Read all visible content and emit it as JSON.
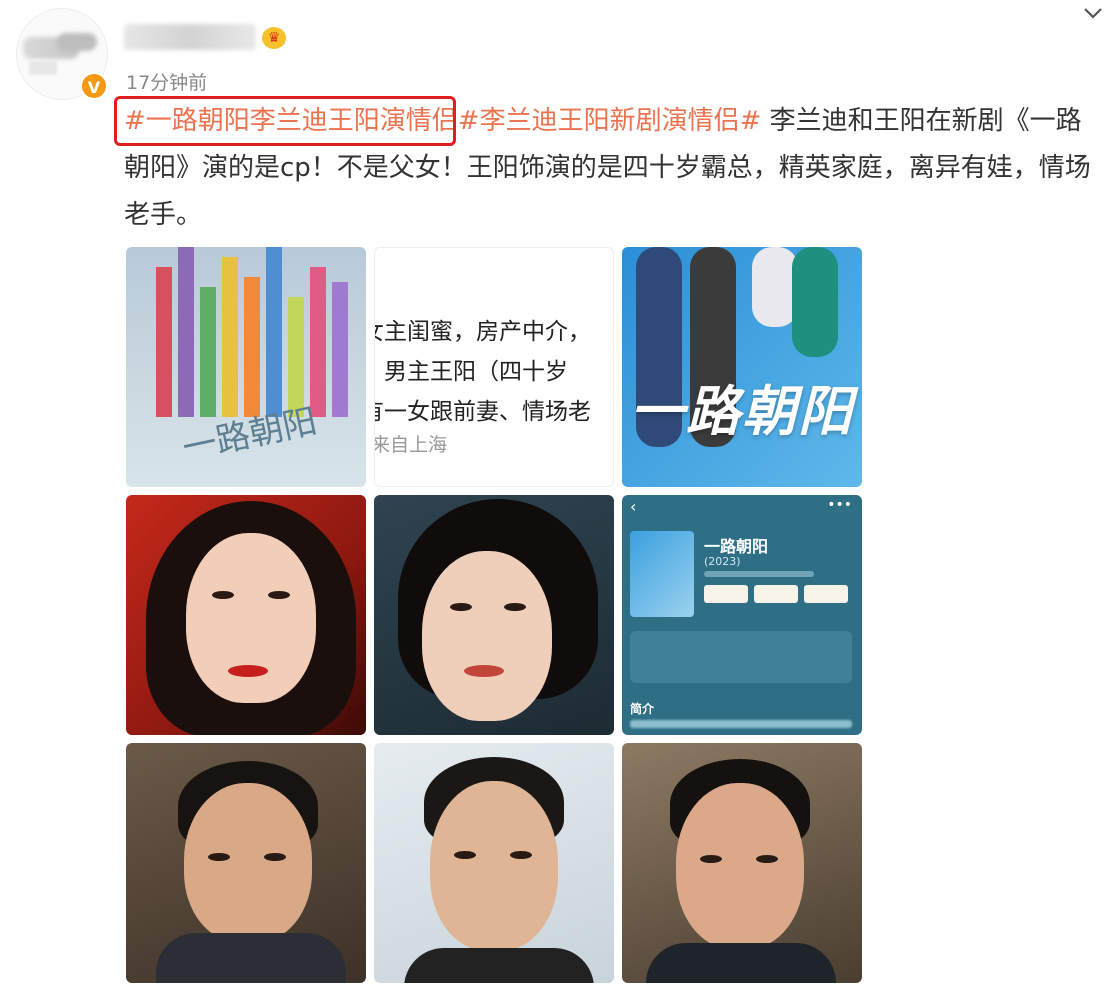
{
  "post": {
    "time": "17分钟前",
    "verified_mark": "V",
    "tag1": "#一路朝阳李兰迪王阳演情侣",
    "tag2": "#李兰迪王阳新剧演情侣#",
    "body": " 李兰迪和王阳在新剧《一路朝阳》演的是cp！不是父女！王阳饰演的是四十岁霸总，精英家庭，离异有娃，情场老手。"
  },
  "images": {
    "poster_title": "一路朝阳",
    "crop_text": {
      "line1": "女主闺蜜，房产中介，",
      "line2": "，男主王阳（四十岁",
      "line3": "有一女跟前妻、情场老",
      "source": "来自上海"
    },
    "poster2_title": "一路朝阳",
    "app_card": {
      "title": "一路朝阳",
      "year": "(2023)",
      "intro": "简介"
    }
  },
  "colors": {
    "tag": "#eb7350",
    "highlight_border": "#e02020",
    "timestamp": "#888888"
  }
}
